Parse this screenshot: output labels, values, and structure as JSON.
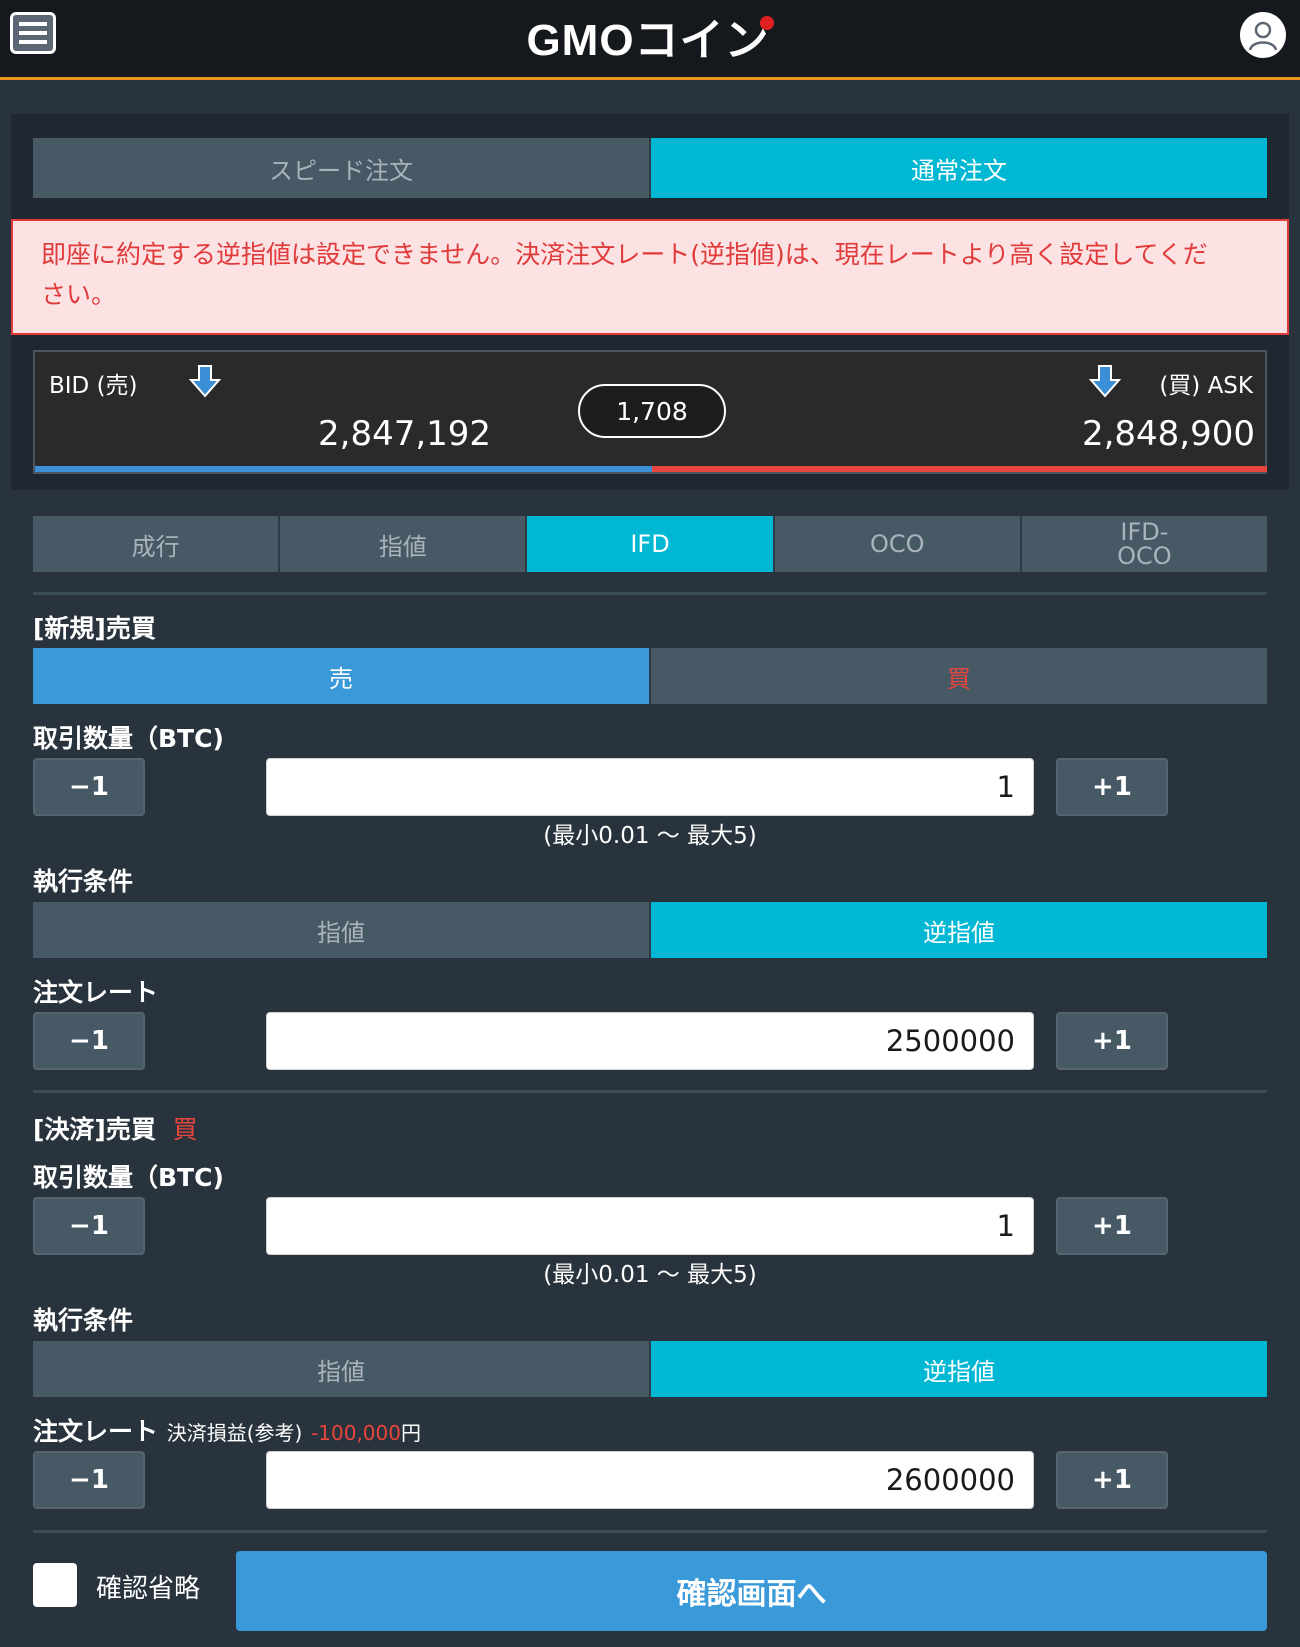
{
  "header": {
    "logo_text": "GMOコイン"
  },
  "order_mode_tabs": [
    {
      "label": "スピード注文",
      "active": false
    },
    {
      "label": "通常注文",
      "active": true
    }
  ],
  "error_message_line1": "即座に約定する逆指値は設定できません。決済注文レート(逆指値)は、現在レートより高く設定してくだ",
  "error_message_line2": "さい。",
  "rates": {
    "bid_label": "BID (売)",
    "bid_value": "2,847,192",
    "spread": "1,708",
    "ask_label": "(買) ASK",
    "ask_value": "2,848,900"
  },
  "order_type_tabs": [
    {
      "label": "成行"
    },
    {
      "label": "指値"
    },
    {
      "label": "IFD",
      "active": true
    },
    {
      "label": "OCO"
    },
    {
      "label_line1": "IFD-",
      "label_line2": "OCO"
    }
  ],
  "new_order": {
    "section_label": "[新規]売買",
    "sell_label": "売",
    "buy_label": "買",
    "quantity_label": "取引数量（BTC)",
    "minus_label": "−1",
    "plus_label": "+1",
    "quantity_value": "1",
    "quantity_hint": "(最小0.01 ～ 最大5)",
    "exec_label": "執行条件",
    "exec_limit": "指値",
    "exec_stop": "逆指値",
    "rate_label": "注文レート",
    "rate_value": "2500000"
  },
  "settle_order": {
    "section_label": "[決済]売買",
    "side": "買",
    "quantity_label": "取引数量（BTC)",
    "minus_label": "−1",
    "plus_label": "+1",
    "quantity_value": "1",
    "quantity_hint": "(最小0.01 ～ 最大5)",
    "exec_label": "執行条件",
    "exec_limit": "指値",
    "exec_stop": "逆指値",
    "rate_label": "注文レート",
    "pl_label": "決済損益(参考)",
    "pl_value": "-100,000",
    "pl_unit": "円",
    "rate_value": "2600000"
  },
  "footer": {
    "skip_confirm_label": "確認省略",
    "confirm_button": "確認画面へ"
  },
  "colors": {
    "accent_cyan": "#00b8d4",
    "sell_blue": "#3a9ad9",
    "buy_red": "#e8453c",
    "header_border": "#e8961c"
  }
}
